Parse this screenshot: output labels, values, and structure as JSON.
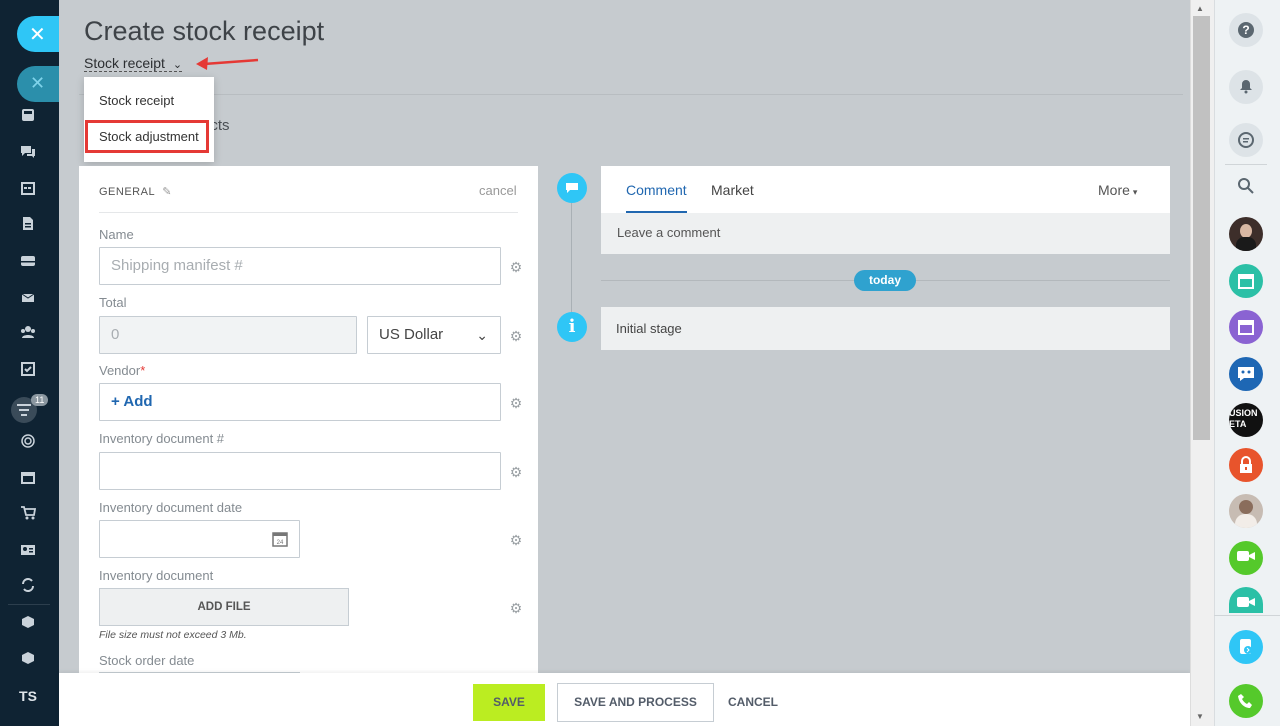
{
  "page": {
    "title": "Create stock receipt"
  },
  "doc_type": {
    "selected": "Stock receipt",
    "options": [
      "Stock receipt",
      "Stock adjustment"
    ]
  },
  "hidden_tab": "ucts",
  "general": {
    "section_title": "GENERAL",
    "cancel_label": "cancel",
    "name_label": "Name",
    "name_placeholder": "Shipping manifest #",
    "total_label": "Total",
    "total_value": "0",
    "currency": "US Dollar",
    "vendor_label": "Vendor",
    "vendor_add": "+ Add",
    "inventory_doc_num_label": "Inventory document #",
    "inventory_doc_date_label": "Inventory document date",
    "inventory_doc_label": "Inventory document",
    "add_file": "ADD FILE",
    "file_note": "File size must not exceed 3 Mb.",
    "stock_order_date_label": "Stock order date"
  },
  "timeline": {
    "tabs": [
      "Comment",
      "Market"
    ],
    "more": "More",
    "comment_placeholder": "Leave a comment",
    "today_badge": "today",
    "initial_stage": "Initial stage"
  },
  "footer": {
    "save": "SAVE",
    "save_process": "SAVE AND PROCESS",
    "cancel": "CANCEL"
  },
  "left_nav": {
    "badge_count": "11",
    "user_initials": "TS"
  },
  "right_nav": {
    "avatar_text": "USION ETA"
  },
  "colors": {
    "accent_blue": "#2fc6f6",
    "save_green": "#bbed21",
    "highlight_red": "#e53935"
  }
}
